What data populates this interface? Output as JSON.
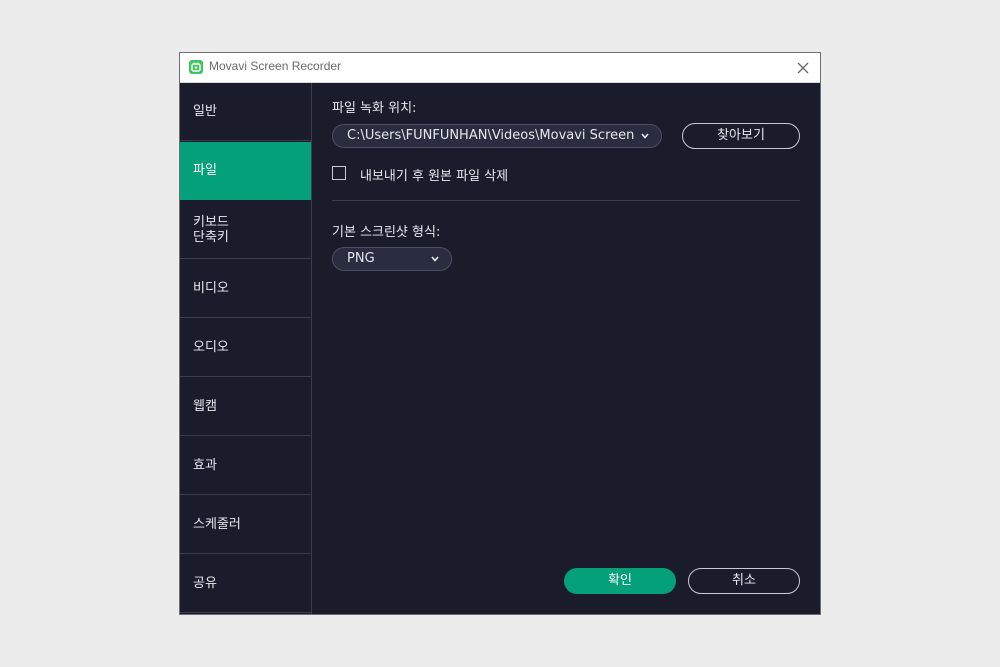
{
  "window": {
    "title": "Movavi Screen Recorder"
  },
  "sidebar": {
    "items": [
      {
        "label": "일반"
      },
      {
        "label": "파일"
      },
      {
        "label": "키보드\n단축키"
      },
      {
        "label": "비디오"
      },
      {
        "label": "오디오"
      },
      {
        "label": "웹캠"
      },
      {
        "label": "효과"
      },
      {
        "label": "스케줄러"
      },
      {
        "label": "공유"
      }
    ],
    "active_index": 1
  },
  "file_settings": {
    "location_label": "파일 녹화 위치:",
    "location_value": "C:\\Users\\FUNFUNHAN\\Videos\\Movavi Screen Recorder",
    "browse_label": "찾아보기",
    "delete_after_export_label": "내보내기 후 원본 파일 삭제",
    "delete_after_export_checked": false,
    "screenshot_format_label": "기본 스크린샷 형식:",
    "screenshot_format_value": "PNG"
  },
  "footer": {
    "ok_label": "확인",
    "cancel_label": "취소"
  },
  "colors": {
    "accent": "#04a07a",
    "background": "#1b1c2b",
    "app_icon": "#3fc45f"
  },
  "icons": {
    "app": "movavi-app-icon",
    "close": "close-icon",
    "dropdown": "chevron-down-icon"
  }
}
